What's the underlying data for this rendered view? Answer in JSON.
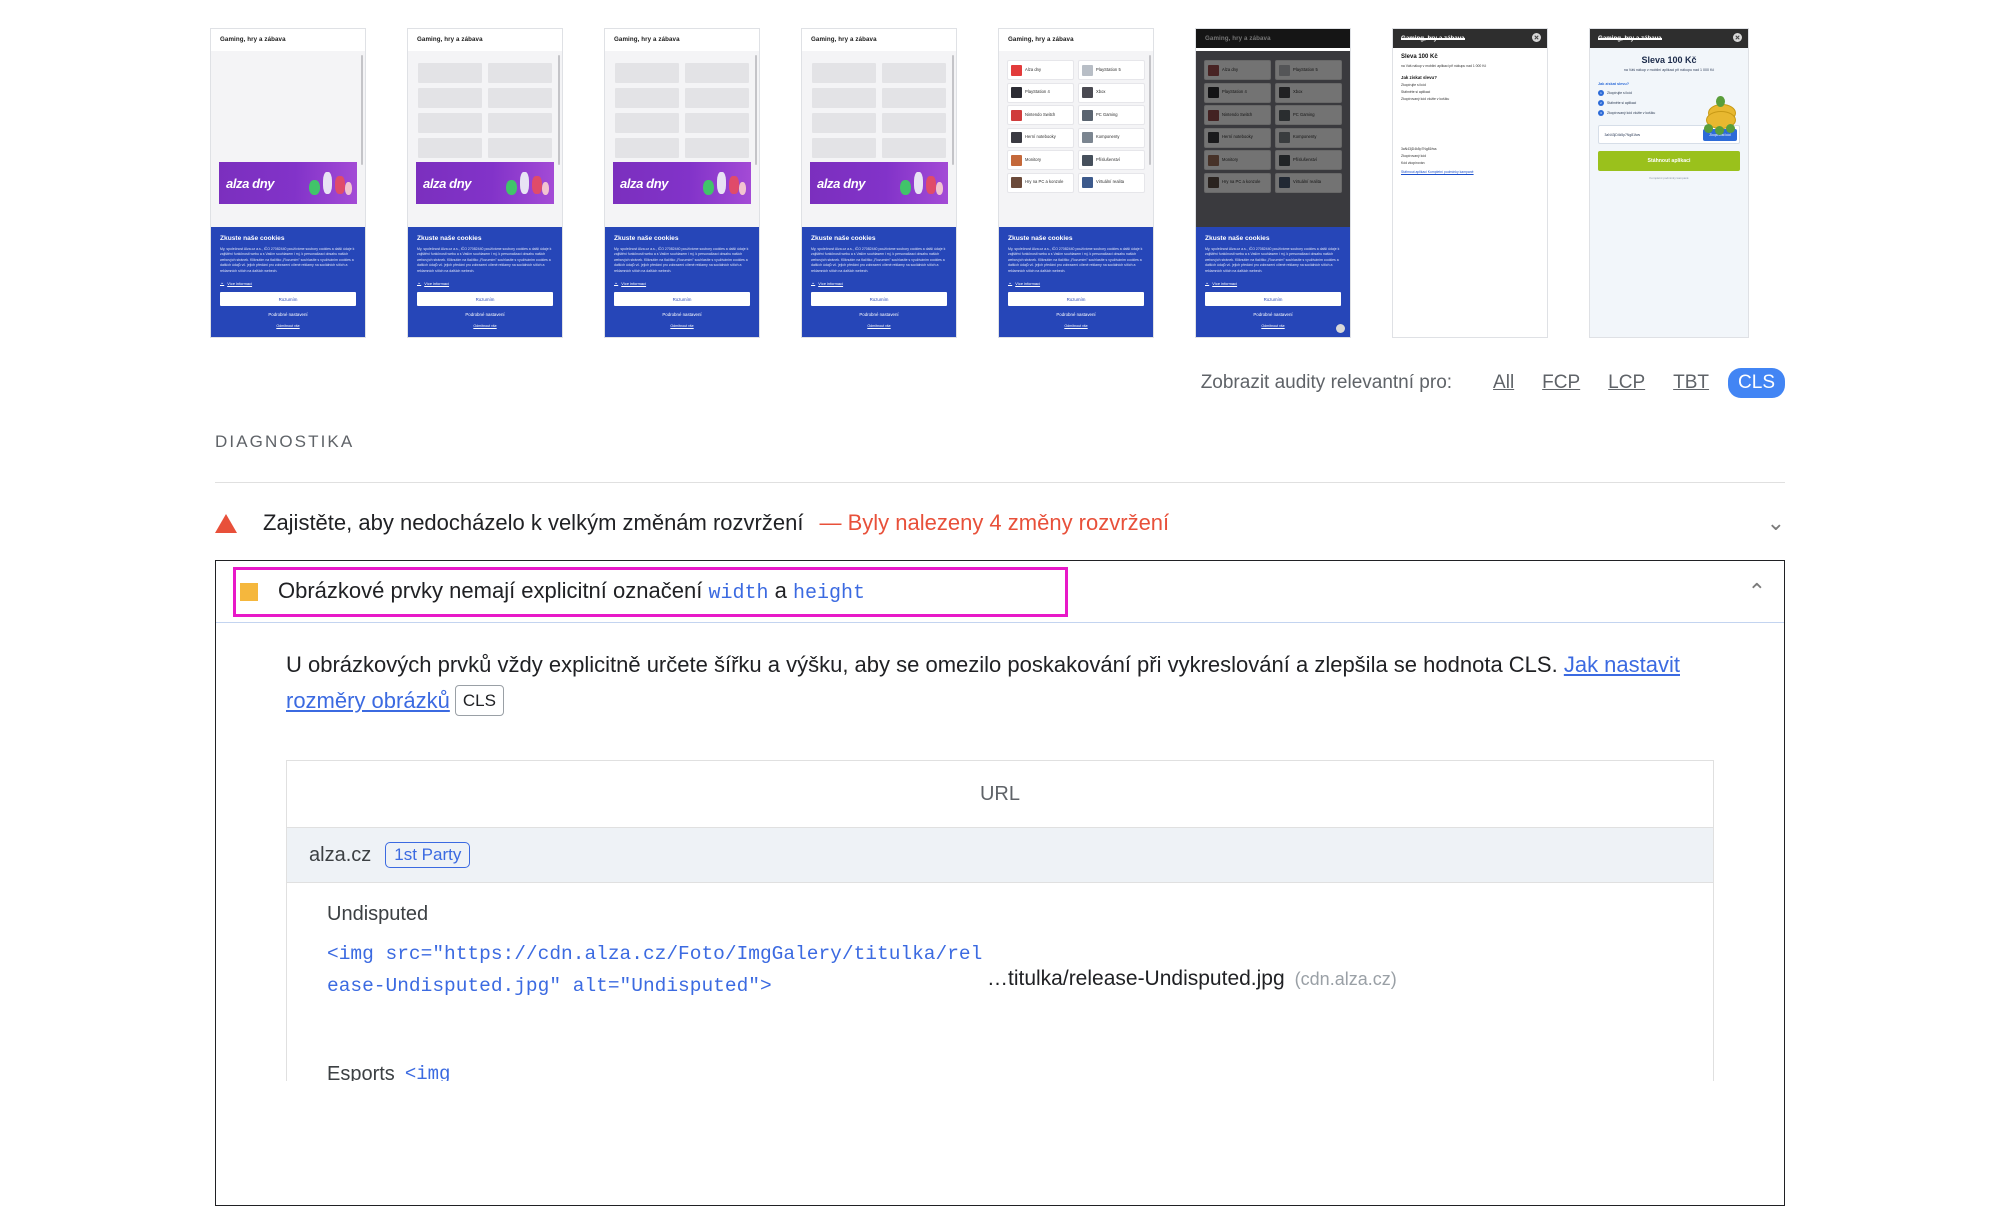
{
  "filmstrip": {
    "shots": [
      {
        "id": "shot-1",
        "header": "Gaming, hry a zábava",
        "kind": "banner-cookie"
      },
      {
        "id": "shot-2",
        "header": "Gaming, hry a zábava",
        "kind": "skeleton-cookie"
      },
      {
        "id": "shot-3",
        "header": "Gaming, hry a zábava",
        "kind": "skeleton-cookie"
      },
      {
        "id": "shot-4",
        "header": "Gaming, hry a zábava",
        "kind": "skeleton-cookie"
      },
      {
        "id": "shot-5",
        "header": "Gaming, hry a zábava",
        "kind": "categories-cookie"
      },
      {
        "id": "shot-6",
        "header": "Gaming, hry a zábava",
        "kind": "categories-cookie-dimmed"
      },
      {
        "id": "shot-7",
        "header": "Gaming, hry a zábava",
        "kind": "promo-plain"
      },
      {
        "id": "shot-8",
        "header": "Gaming, hry a zábava",
        "kind": "promo-card"
      }
    ],
    "alza_banner_text": "alza dny",
    "categories": [
      "Alza dny",
      "PlayStation 5",
      "PlayStation 4",
      "Xbox",
      "Nintendo Switch",
      "PC Gaming",
      "Herní notebooky",
      "Komponenty",
      "Monitory",
      "Příslušenství",
      "Hry na PC a konzole",
      "Virtuální realita"
    ],
    "cookie": {
      "title": "Zkuste naše cookies",
      "body": "My, společnost Alza.cz a.s., IČO 27082440 používáme soubory cookies a další údaje k zajištění funkčnosti webu a s Vaším souhlasem i mj. k personalizaci obsahu našich webových stránek. Kliknutím na tlačítko „Rozumím\" souhlasíte s využíváním cookies a dalších údajů vč. jejich předání pro zobrazení cílené reklamy na sociálních sítích a reklamních sítích na dalších webech.",
      "more_label": "Více informací",
      "accept_label": "Rozumím",
      "settings_label": "Podrobné nastavení",
      "deny_label": "Odmítnout vše"
    },
    "promo": {
      "title": "Sleva 100 Kč",
      "subtitle": "na Váš nákup v mobilní aplikaci při nákupu nad 1 000 Kč",
      "how_label": "Jak získat slevu?",
      "steps": [
        "Zkopírujte si kód",
        "Stáhněte si aplikaci",
        "Zkopírovaný kód vložte v košíku"
      ],
      "code": "3aN43jD4k5p7Ng81fws",
      "copy_label": "Zkopírovat kód",
      "download_label": "Stáhnout aplikaci",
      "terms_label": "Kompletní podmínky kampaně",
      "plain_line1": "Zkopírovaný kód",
      "plain_line2": "Kód zkopírován",
      "plain_link": "Stáhnout aplikaci Kompletní podmínky kampaně"
    }
  },
  "filter": {
    "label": "Zobrazit audity relevantní pro:",
    "options": [
      "All",
      "FCP",
      "LCP",
      "TBT",
      "CLS"
    ],
    "active": "CLS",
    "active_color": "#4285f4"
  },
  "diagnostics": {
    "section_title": "DIAGNOSTIKA",
    "audit": {
      "title": "Zajistěte, aby nedocházelo k velkým změnám rozvržení",
      "dash": "—",
      "subtitle": "Byly nalezeny 4 změny rozvržení",
      "severity_color": "#e8503a",
      "chevron": "⌄"
    }
  },
  "panel": {
    "icon_color": "#f5b73d",
    "highlight_color": "#e818c8",
    "title_part1": "Obrázkové prvky nemají explicitní označení",
    "title_code1": "width",
    "title_join": "a",
    "title_code2": "height",
    "chevron": "⌃",
    "description_part1": "U obrázkových prvků vždy explicitně určete šířku a výšku, aby se omezilo poskakování při vykreslování a zlepšila se hodnota CLS.",
    "description_link": "Jak nastavit rozměry obrázků",
    "description_tag": "CLS",
    "table": {
      "header": "URL",
      "group": {
        "name": "alza.cz",
        "badge": "1st Party"
      },
      "rows": [
        {
          "label": "Undisputed",
          "code": "<img src=\"https://cdn.alza.cz/Foto/ImgGalery/titulka/release-Undisputed.jpg\" alt=\"Undisputed\">",
          "url": "…titulka/release-Undisputed.jpg",
          "host": "(cdn.alza.cz)"
        }
      ],
      "next_row_label": "Esports",
      "next_row_code": "<img"
    }
  }
}
